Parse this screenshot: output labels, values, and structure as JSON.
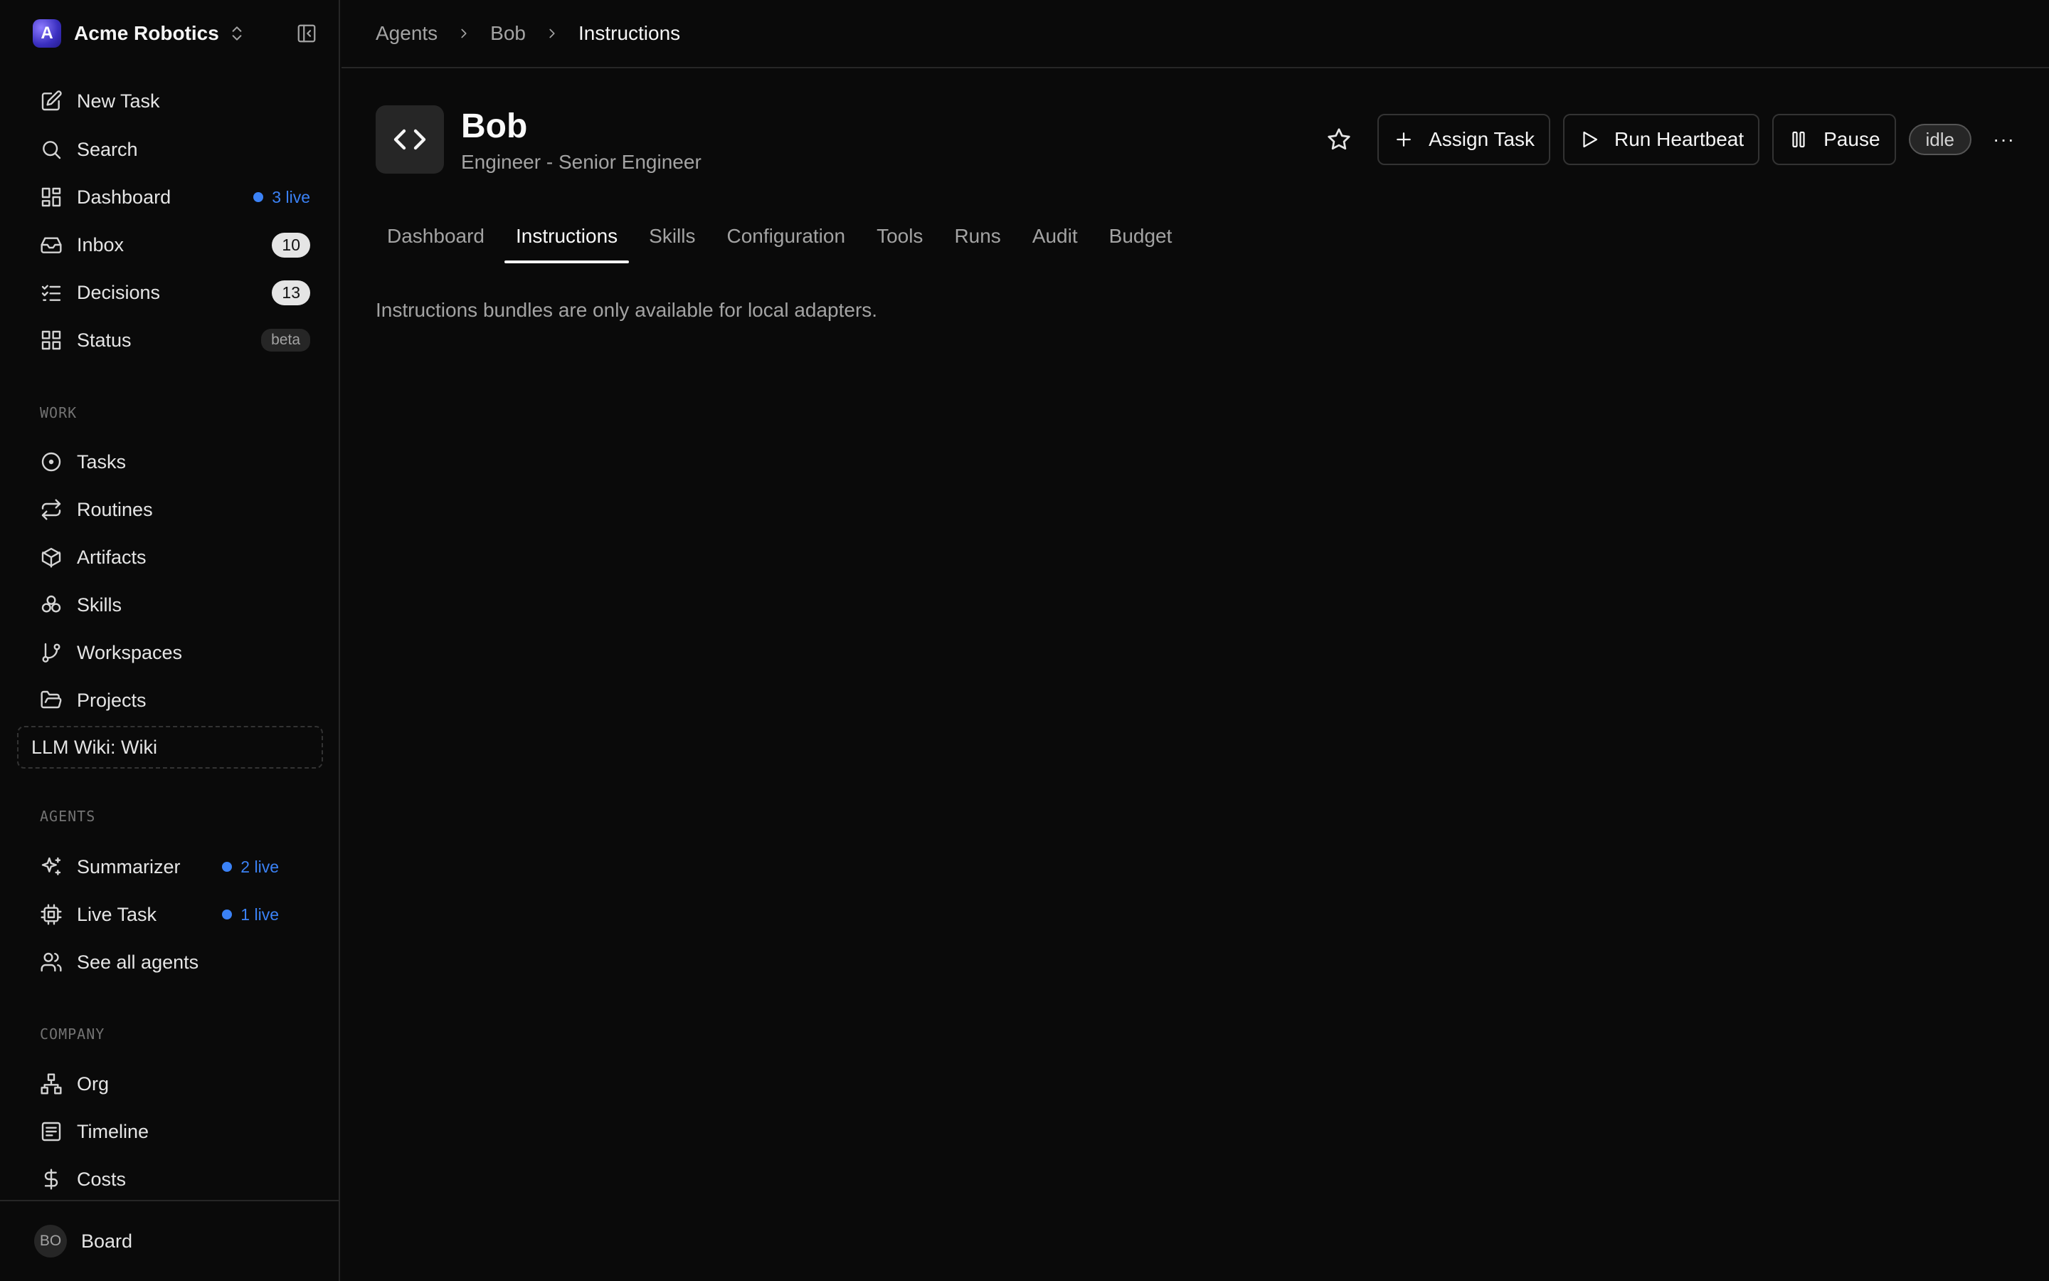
{
  "workspace": {
    "logo_letter": "A",
    "name": "Acme Robotics"
  },
  "nav_primary": [
    {
      "label": "New Task"
    },
    {
      "label": "Search"
    },
    {
      "label": "Dashboard",
      "live": "3 live"
    },
    {
      "label": "Inbox",
      "count": "10"
    },
    {
      "label": "Decisions",
      "count": "13"
    },
    {
      "label": "Status",
      "badge": "beta"
    }
  ],
  "sections": {
    "work": "WORK",
    "agents": "AGENTS",
    "company": "COMPANY"
  },
  "nav_work": [
    {
      "label": "Tasks"
    },
    {
      "label": "Routines"
    },
    {
      "label": "Artifacts"
    },
    {
      "label": "Skills"
    },
    {
      "label": "Workspaces"
    },
    {
      "label": "Projects"
    }
  ],
  "wiki": {
    "label": "LLM Wiki: Wiki"
  },
  "nav_agents": [
    {
      "label": "Summarizer",
      "live": "2 live"
    },
    {
      "label": "Live Task",
      "live": "1 live"
    },
    {
      "label": "See all agents"
    }
  ],
  "nav_company": [
    {
      "label": "Org"
    },
    {
      "label": "Timeline"
    },
    {
      "label": "Costs"
    }
  ],
  "board": {
    "initials": "BO",
    "label": "Board"
  },
  "breadcrumb": [
    "Agents",
    "Bob",
    "Instructions"
  ],
  "agent": {
    "name": "Bob",
    "role": "Engineer - Senior Engineer",
    "status": "idle"
  },
  "actions": {
    "assign": "Assign Task",
    "heartbeat": "Run Heartbeat",
    "pause": "Pause",
    "more": "···"
  },
  "tabs": [
    "Dashboard",
    "Instructions",
    "Skills",
    "Configuration",
    "Tools",
    "Runs",
    "Audit",
    "Budget"
  ],
  "active_tab": "Instructions",
  "message": "Instructions bundles are only available for local adapters.",
  "colors": {
    "accent_live": "#3b82f6",
    "background": "#0a0a0a"
  }
}
